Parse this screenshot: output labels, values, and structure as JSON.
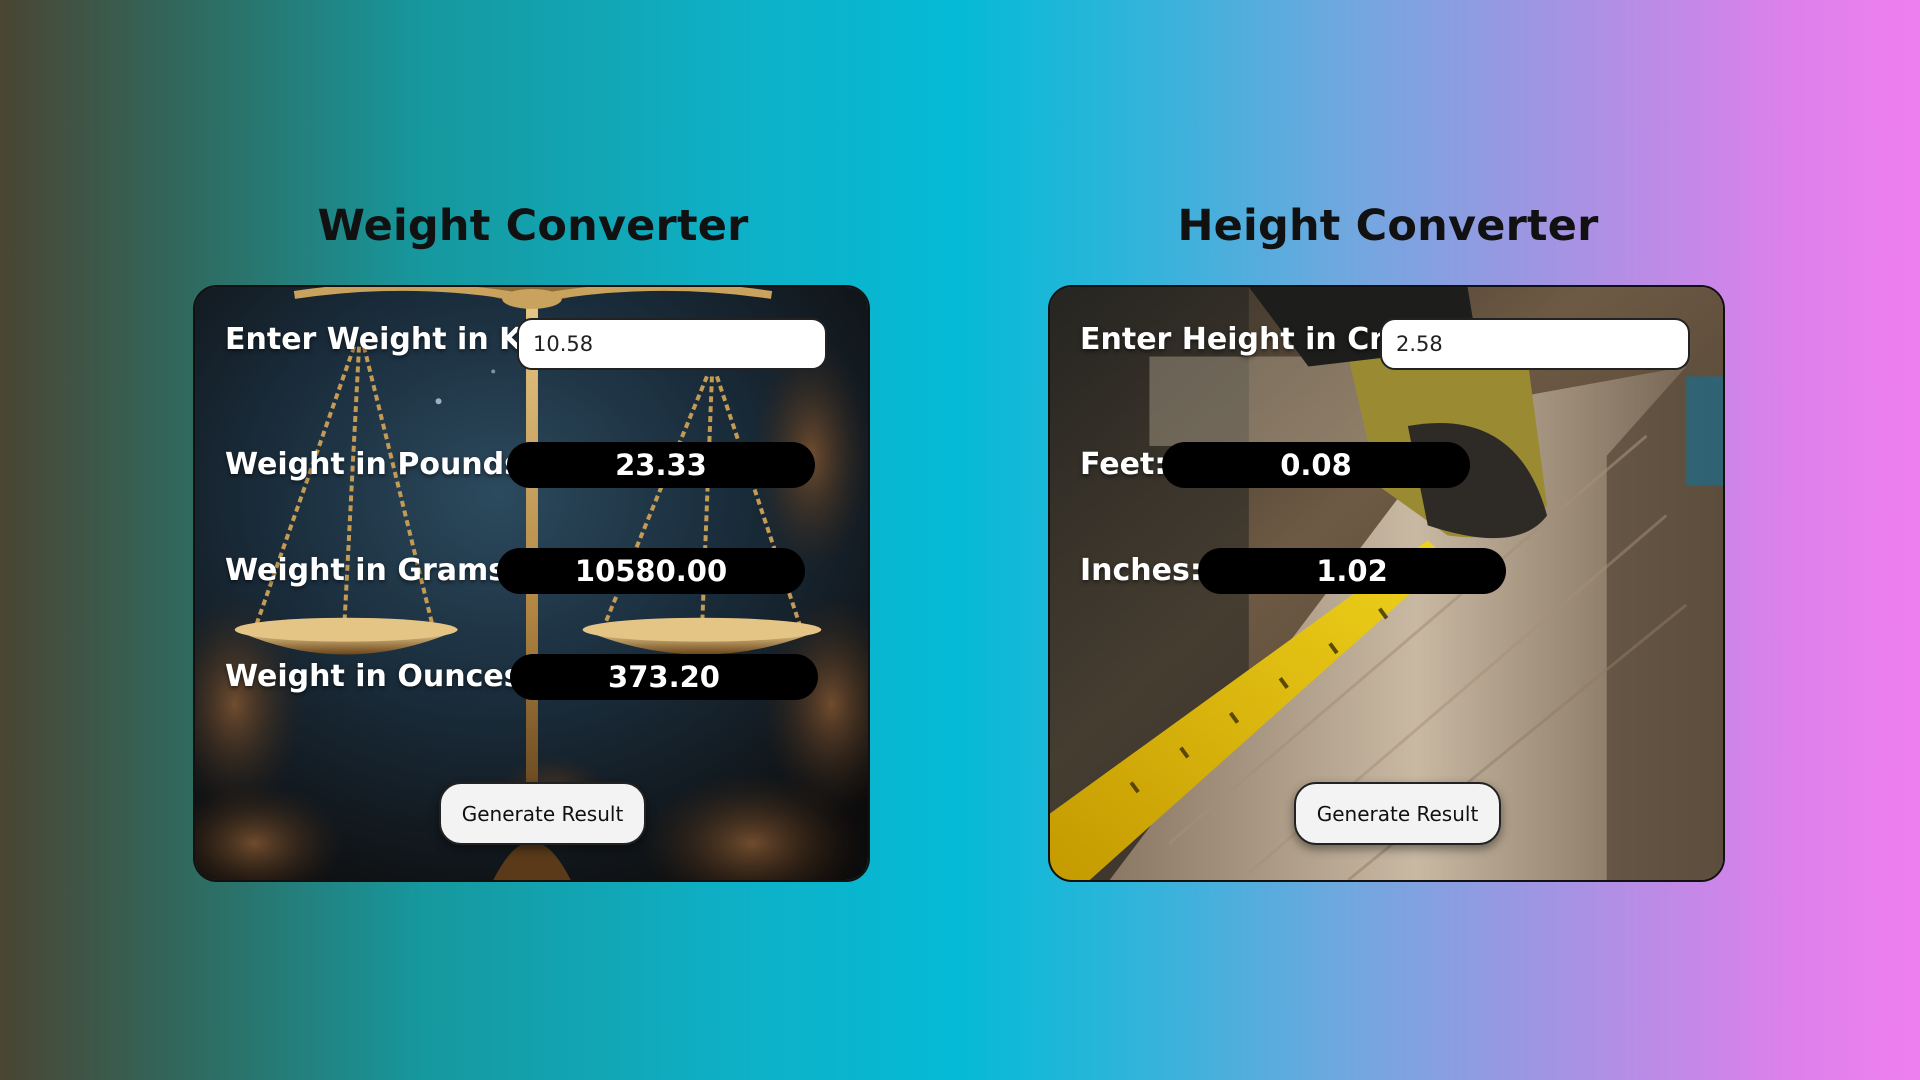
{
  "weight": {
    "title": "Weight Converter",
    "input_label": "Enter Weight in Kg:",
    "input_value": "10.58",
    "rows": [
      {
        "label": "Weight in Pounds:",
        "value": "23.33"
      },
      {
        "label": "Weight in Grams:",
        "value": "10580.00"
      },
      {
        "label": "Weight in Ounces:",
        "value": "373.20"
      }
    ],
    "button_label": "Generate Result"
  },
  "height": {
    "title": "Height Converter",
    "input_label": "Enter Height in Cm:",
    "input_value": "2.58",
    "rows": [
      {
        "label": "Feet:",
        "value": "0.08"
      },
      {
        "label": "Inches:",
        "value": "1.02"
      }
    ],
    "button_label": "Generate Result"
  },
  "icons": {
    "weight_background": "balance-scale-image",
    "height_background": "measuring-tape-image"
  },
  "colors": {
    "gradient_left": "#4a4533",
    "gradient_mid": "#05bad6",
    "gradient_right": "#ef7fee",
    "result_background": "#000000",
    "label_text": "#ffffff"
  }
}
